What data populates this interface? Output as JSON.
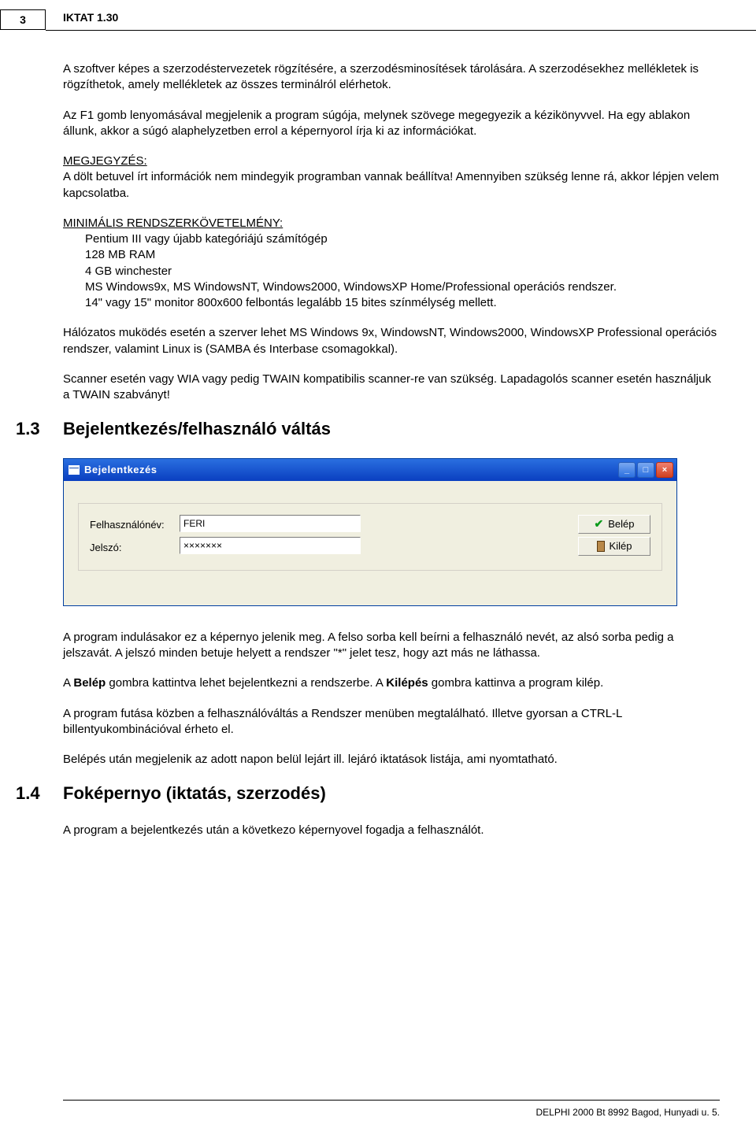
{
  "header": {
    "page_number": "3",
    "title": "IKTAT 1.30"
  },
  "body": {
    "p1": "A szoftver képes a szerzodéstervezetek rögzítésére, a szerzodésminosítések tárolására. A szerzodésekhez mellékletek is rögzíthetok, amely mellékletek az összes terminálról elérhetok.",
    "p2": "Az F1 gomb lenyomásával megjelenik a program súgója, melynek szövege megegyezik a kézikönyvvel. Ha egy ablakon állunk, akkor a súgó alaphelyzetben errol a képernyorol írja ki az információkat.",
    "note_label": "MEGJEGYZÉS:",
    "note_text": "A dölt betuvel írt információk nem mindegyik programban vannak beállítva! Amennyiben szükség lenne rá, akkor lépjen velem kapcsolatba.",
    "req_label": "MINIMÁLIS RENDSZERKÖVETELMÉNY:",
    "req_l1": "Pentium III vagy újabb kategóriájú számítógép",
    "req_l2": "128 MB RAM",
    "req_l3": "4 GB winchester",
    "req_l4": "MS Windows9x, MS WindowsNT, Windows2000, WindowsXP Home/Professional operációs rendszer.",
    "req_l5": "14\" vagy 15\" monitor 800x600 felbontás legalább 15 bites színmélység mellett.",
    "p3": "Hálózatos muködés esetén a szerver lehet MS Windows 9x, WindowsNT, Windows2000, WindowsXP Professional operációs rendszer, valamint Linux is (SAMBA és Interbase csomagokkal).",
    "p4": "Scanner esetén vagy WIA vagy pedig TWAIN kompatibilis scanner-re van szükség. Lapadagolós scanner esetén használjuk a TWAIN szabványt!",
    "sec13_num": "1.3",
    "sec13_title": "Bejelentkezés/felhasználó váltás",
    "p5": "A program indulásakor ez a képernyo jelenik meg. A felso sorba kell beírni a felhasználó nevét, az alsó sorba pedig a jelszavát. A jelszó minden betuje helyett a rendszer \"*\" jelet tesz, hogy azt más ne láthassa.",
    "p6a": "A ",
    "p6b": "Belép",
    "p6c": " gombra kattintva lehet bejelentkezni a rendszerbe. A ",
    "p6d": "Kilépés",
    "p6e": " gombra kattinva a program kilép.",
    "p7": "A program futása közben a felhasználóváltás a Rendszer menüben megtalálható. Illetve gyorsan a CTRL-L billentyukombinációval érheto el.",
    "p8": "Belépés után megjelenik az adott napon belül lejárt ill. lejáró iktatások listája, ami nyomtatható.",
    "sec14_num": "1.4",
    "sec14_title": "Foképernyo (iktatás, szerzodés)",
    "p9": "A program a bejelentkezés után a következo képernyovel fogadja a felhasználót."
  },
  "window": {
    "title": "Bejelentkezés",
    "label_user": "Felhasználónév:",
    "label_pass": "Jelszó:",
    "value_user": "FERI",
    "value_pass": "×××××××",
    "btn_login": "Belép",
    "btn_exit": "Kilép",
    "sys_min": "_",
    "sys_max": "□",
    "sys_close": "×"
  },
  "footer": "DELPHI 2000 Bt 8992 Bagod, Hunyadi u. 5."
}
